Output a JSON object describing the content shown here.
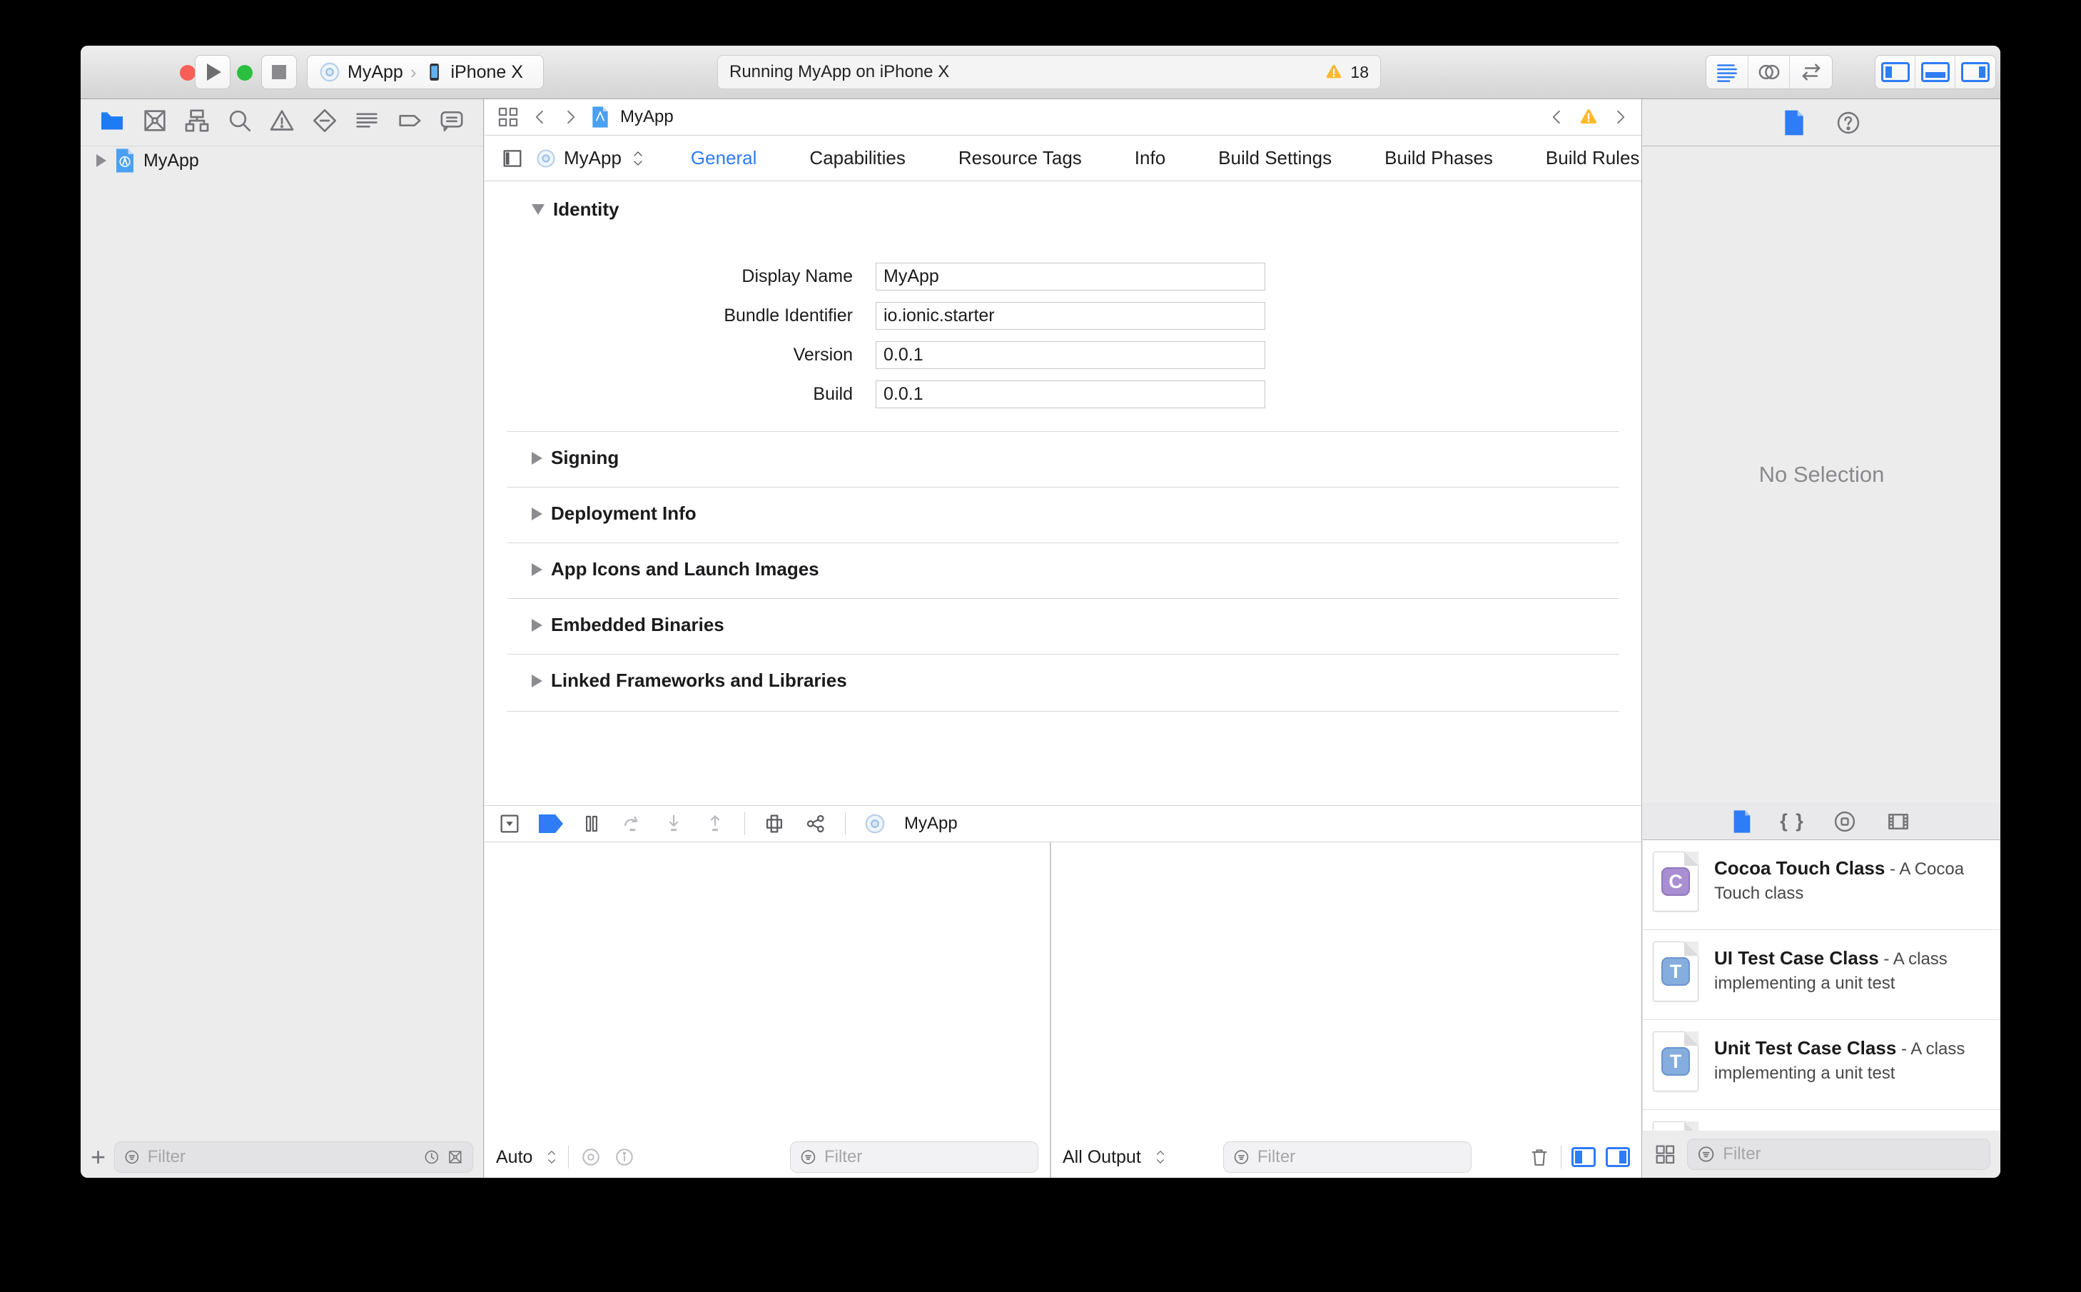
{
  "colors": {
    "accent": "#2e7cf6",
    "warning": "#fdb92b"
  },
  "toolbar": {
    "scheme_project": "MyApp",
    "scheme_device": "iPhone X",
    "status_text": "Running MyApp on iPhone X",
    "warning_count": "18"
  },
  "navigator": {
    "project_name": "MyApp",
    "add_glyph": "+",
    "filter_placeholder": "Filter"
  },
  "editor": {
    "jumpbar_file": "MyApp",
    "target_name": "MyApp",
    "tabs": [
      "General",
      "Capabilities",
      "Resource Tags",
      "Info",
      "Build Settings",
      "Build Phases",
      "Build Rules"
    ],
    "identity": {
      "title": "Identity",
      "fields": [
        {
          "label": "Display Name",
          "value": "MyApp"
        },
        {
          "label": "Bundle Identifier",
          "value": "io.ionic.starter"
        },
        {
          "label": "Version",
          "value": "0.0.1"
        },
        {
          "label": "Build",
          "value": "0.0.1"
        }
      ]
    },
    "collapsed_sections": [
      "Signing",
      "Deployment Info",
      "App Icons and Launch Images",
      "Embedded Binaries",
      "Linked Frameworks and Libraries"
    ]
  },
  "debug": {
    "bar_target": "MyApp",
    "variables_scope": "Auto",
    "console_scope": "All Output",
    "variables_filter_placeholder": "Filter",
    "console_filter_placeholder": "Filter"
  },
  "inspector": {
    "empty_text": "No Selection",
    "library": {
      "braces_glyph": "{ }",
      "items": [
        {
          "badge": "C",
          "title": "Cocoa Touch Class",
          "desc": "- A Cocoa Touch class"
        },
        {
          "badge": "T",
          "title": "UI Test Case Class",
          "desc": "- A class implementing a unit test"
        },
        {
          "badge": "T",
          "title": "Unit Test Case Class",
          "desc": "- A class implementing a unit test"
        }
      ],
      "filter_placeholder": "Filter"
    }
  }
}
